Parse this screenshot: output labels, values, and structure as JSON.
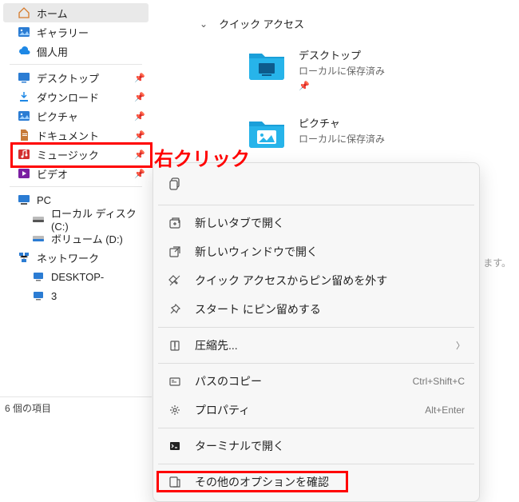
{
  "sidebar": {
    "home": "ホーム",
    "gallery": "ギャラリー",
    "personal": "個人用",
    "desktop": "デスクトップ",
    "downloads": "ダウンロード",
    "pictures": "ピクチャ",
    "documents": "ドキュメント",
    "music": "ミュージック",
    "video": "ビデオ",
    "pc": "PC",
    "localdisk": "ローカル ディスク (C:)",
    "volume": "ボリューム (D:)",
    "network": "ネットワーク",
    "desktop_host1": "DESKTOP-",
    "desktop_host2": "3"
  },
  "content": {
    "quick_access": "クイック アクセス",
    "folders": [
      {
        "name": "デスクトップ",
        "sub": "ローカルに保存済み"
      },
      {
        "name": "ピクチャ",
        "sub": "ローカルに保存済み"
      }
    ],
    "truncated": "ます。"
  },
  "status": "6 個の項目",
  "context_menu": {
    "new_tab": "新しいタブで開く",
    "new_window": "新しいウィンドウで開く",
    "unpin_quick": "クイック アクセスからピン留めを外す",
    "pin_start": "スタート にピン留めする",
    "compress": "圧縮先...",
    "copy_path": "パスのコピー",
    "copy_path_sc": "Ctrl+Shift+C",
    "properties": "プロパティ",
    "properties_sc": "Alt+Enter",
    "terminal": "ターミナルで開く",
    "more_options": "その他のオプションを確認"
  },
  "annotation": {
    "right_click": "右クリック"
  }
}
